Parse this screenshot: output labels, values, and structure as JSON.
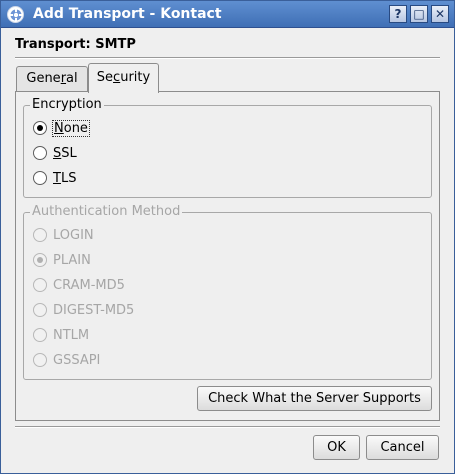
{
  "window": {
    "title": "Add Transport - Kontact",
    "controls": {
      "help": "?",
      "maximize": "□",
      "close": "✕"
    },
    "icon": "kontact-app-icon"
  },
  "heading": "Transport: SMTP",
  "tabs": [
    {
      "label": "General",
      "active": false
    },
    {
      "label": "Security",
      "active": true
    }
  ],
  "encryption": {
    "label": "Encryption",
    "options": [
      {
        "label": "None",
        "checked": true
      },
      {
        "label": "SSL",
        "checked": false
      },
      {
        "label": "TLS",
        "checked": false
      }
    ]
  },
  "auth": {
    "label": "Authentication Method",
    "enabled": false,
    "options": [
      {
        "label": "LOGIN",
        "checked": false
      },
      {
        "label": "PLAIN",
        "checked": true
      },
      {
        "label": "CRAM-MD5",
        "checked": false
      },
      {
        "label": "DIGEST-MD5",
        "checked": false
      },
      {
        "label": "NTLM",
        "checked": false
      },
      {
        "label": "GSSAPI",
        "checked": false
      }
    ]
  },
  "buttons": {
    "check_server": "Check What the Server Supports",
    "ok": "OK",
    "cancel": "Cancel"
  },
  "colors": {
    "titlebar": "#4f7fc4",
    "disabled_text": "#a6a6a6"
  }
}
